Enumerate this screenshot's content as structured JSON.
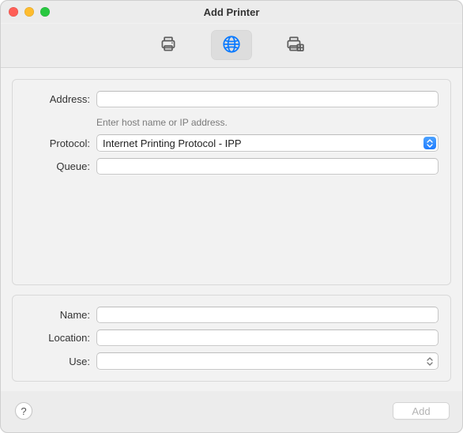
{
  "window": {
    "title": "Add Printer"
  },
  "tabs": {
    "default": "printer-default-icon",
    "ip": "globe-icon",
    "windows": "printer-windows-icon",
    "selected": "ip"
  },
  "form_top": {
    "address_label": "Address:",
    "address_value": "",
    "address_hint": "Enter host name or IP address.",
    "protocol_label": "Protocol:",
    "protocol_value": "Internet Printing Protocol - IPP",
    "queue_label": "Queue:",
    "queue_value": ""
  },
  "form_bottom": {
    "name_label": "Name:",
    "name_value": "",
    "location_label": "Location:",
    "location_value": "",
    "use_label": "Use:",
    "use_value": ""
  },
  "footer": {
    "help_label": "?",
    "add_label": "Add"
  }
}
